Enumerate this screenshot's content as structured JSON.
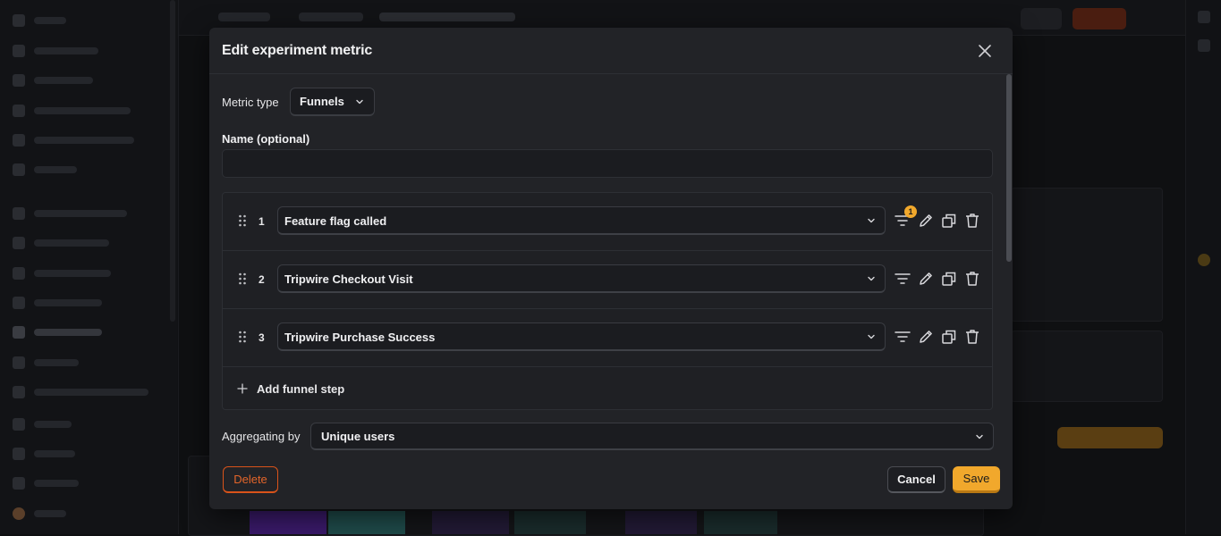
{
  "modal": {
    "title": "Edit experiment metric",
    "metric_type": {
      "label": "Metric type",
      "value": "Funnels"
    },
    "name": {
      "label": "Name (optional)",
      "value": "",
      "placeholder": ""
    },
    "steps": [
      {
        "number": "1",
        "event": "Feature flag called",
        "filter_count": "1"
      },
      {
        "number": "2",
        "event": "Tripwire Checkout Visit"
      },
      {
        "number": "3",
        "event": "Tripwire Purchase Success"
      }
    ],
    "add_step_label": "Add funnel step",
    "aggregating": {
      "label": "Aggregating by",
      "value": "Unique users"
    },
    "buttons": {
      "delete": "Delete",
      "cancel": "Cancel",
      "save": "Save"
    }
  },
  "colors": {
    "accent": "#f1a82c",
    "danger": "#e4652a",
    "modal_bg": "#222327"
  },
  "icons": [
    "close-icon",
    "chevron-down-icon",
    "drag-handle-icon",
    "filter-icon",
    "pencil-icon",
    "copy-icon",
    "trash-icon",
    "plus-icon"
  ]
}
